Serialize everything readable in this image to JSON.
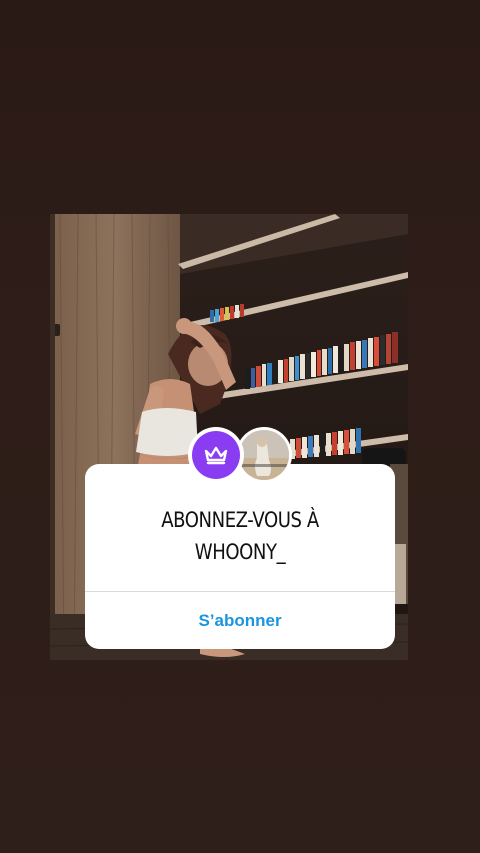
{
  "background": {
    "color_top": "#2a1a16",
    "color_bottom": "#2f1f1a"
  },
  "story": {
    "photo_description_icon": "photo-person-bookshelf-icon"
  },
  "sticker": {
    "crown_icon": "crown-icon",
    "crown_color": "#8a3cf2",
    "title_line1": "ABONNEZ-VOUS À",
    "title_line2": "WHOONY_",
    "button_label": "S’abonner",
    "button_color": "#1b95e0"
  }
}
